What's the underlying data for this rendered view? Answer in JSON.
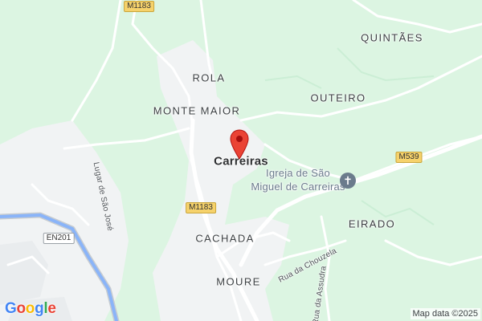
{
  "map": {
    "places": {
      "rola": "ROLA",
      "monte_maior": "MONTE MAIOR",
      "outeiro": "OUTEIRO",
      "quintaes": "QUINTÃES",
      "carreiras": "Carreiras",
      "eirado": "EIRADO",
      "cachada": "CACHADA",
      "moure": "MOURE"
    },
    "poi": {
      "church_line1": "Igreja de São",
      "church_line2": "Miguel de Carreiras",
      "icon": "church-icon"
    },
    "streets": {
      "lugar_sao_jose": "Lugar de São José",
      "rua_chouzela": "Rua da Chouzela",
      "rua_assuda": "Rua da Assudra"
    },
    "road_shields": {
      "m1183_top": "M1183",
      "m1183_mid": "M1183",
      "m539": "M539",
      "en201": "EN201"
    },
    "marker": {
      "icon": "map-pin-icon",
      "color": "#ea4335"
    },
    "colors": {
      "land": "#dcf5e2",
      "builtup": "#f1f3f4",
      "roads": "#ffffff",
      "motorway": "#8ab4f8"
    }
  },
  "footer": {
    "logo_text": "Google",
    "attribution": "Map data ©2025"
  }
}
